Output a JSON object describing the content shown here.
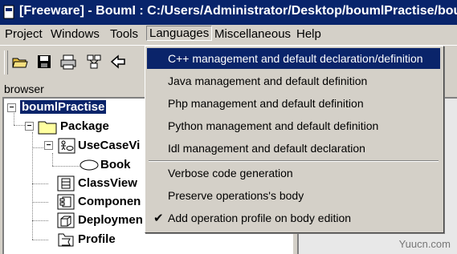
{
  "window": {
    "title": "[Freeware] - BoumI : C:/Users/Administrator/Desktop/boumlPractise/boumlPractise.prj"
  },
  "menubar": {
    "items": [
      {
        "label": "Project"
      },
      {
        "label": "Windows"
      },
      {
        "label": "Tools"
      },
      {
        "label": "Languages"
      },
      {
        "label": "Miscellaneous"
      },
      {
        "label": "Help"
      }
    ]
  },
  "toolbar": {
    "buttons": [
      "open-folder-icon",
      "save-icon",
      "print-icon",
      "diagram-icon",
      "back-arrow-icon"
    ]
  },
  "browser": {
    "label": "browser",
    "nodes": [
      {
        "label": "boumlPractise",
        "icon": "project-icon",
        "selected": true
      },
      {
        "label": "Package",
        "icon": "folder-icon"
      },
      {
        "label": "UseCaseVi",
        "icon": "usecase-view-icon"
      },
      {
        "label": "Book",
        "icon": "usecase-ellipse-icon"
      },
      {
        "label": "ClassView",
        "icon": "class-view-icon"
      },
      {
        "label": "Componen",
        "icon": "component-view-icon"
      },
      {
        "label": "Deploymen",
        "icon": "deployment-view-icon"
      },
      {
        "label": "Profile",
        "icon": "profile-icon"
      }
    ]
  },
  "languages_menu": {
    "items": [
      {
        "label": "C++ management and default declaration/definition",
        "highlighted": true
      },
      {
        "label": "Java management and default definition"
      },
      {
        "label": "Php management and default definition"
      },
      {
        "label": "Python management and default definition"
      },
      {
        "label": "Idl management and default declaration"
      },
      {
        "label": "Verbose code generation"
      },
      {
        "label": "Preserve operations's body"
      },
      {
        "label": "Add operation profile on body edition",
        "checked": true
      }
    ]
  },
  "watermark": "Yuucn.com",
  "colors": {
    "titlebar": "#08246b",
    "highlight": "#0a246a",
    "face": "#d4d0c8"
  }
}
